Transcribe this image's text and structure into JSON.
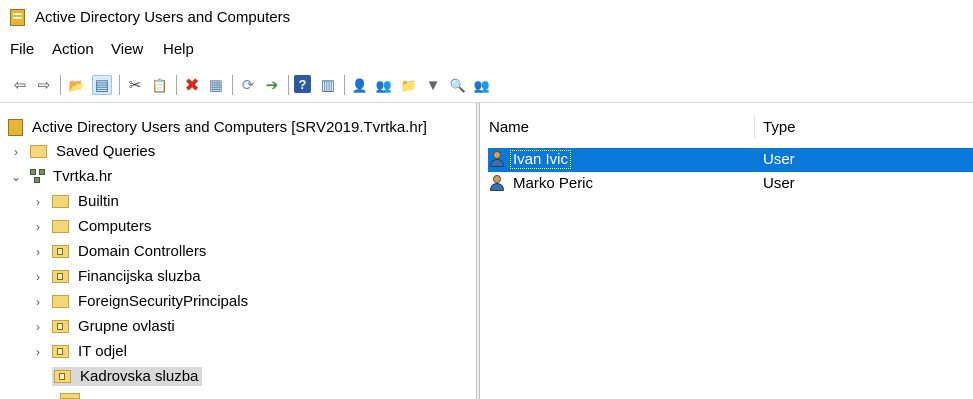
{
  "window": {
    "title": "Active Directory Users and Computers",
    "icon": "aduc-app-icon"
  },
  "menu": [
    {
      "label": "File"
    },
    {
      "label": "Action"
    },
    {
      "label": "View"
    },
    {
      "label": "Help"
    }
  ],
  "toolbar": [
    {
      "name": "back-icon",
      "glyph": "⇦"
    },
    {
      "name": "forward-icon",
      "glyph": "⇨"
    },
    {
      "name": "up-folder-icon",
      "glyph": "📂"
    },
    {
      "name": "show-hide-tree-icon",
      "glyph": "▤"
    },
    {
      "name": "cut-icon",
      "glyph": "✂"
    },
    {
      "name": "copy-icon",
      "glyph": "📋"
    },
    {
      "name": "delete-icon",
      "glyph": "✖"
    },
    {
      "name": "properties-icon",
      "glyph": "▦"
    },
    {
      "name": "refresh-icon",
      "glyph": "⟳"
    },
    {
      "name": "export-list-icon",
      "glyph": "➔"
    },
    {
      "name": "help-icon",
      "glyph": "?"
    },
    {
      "name": "show-pane-icon",
      "glyph": "▥"
    },
    {
      "name": "new-user-icon",
      "glyph": "👤"
    },
    {
      "name": "new-group-icon",
      "glyph": "👥"
    },
    {
      "name": "new-ou-icon",
      "glyph": "📁"
    },
    {
      "name": "filter-icon",
      "glyph": "▼"
    },
    {
      "name": "find-icon",
      "glyph": "🔍"
    },
    {
      "name": "add-to-group-icon",
      "glyph": "👥"
    }
  ],
  "tree": {
    "root": "Active Directory Users and Computers [SRV2019.Tvrtka.hr]",
    "saved_queries": "Saved Queries",
    "domain": "Tvrtka.hr",
    "children": [
      {
        "label": "Builtin",
        "type": "folder"
      },
      {
        "label": "Computers",
        "type": "folder"
      },
      {
        "label": "Domain Controllers",
        "type": "ou"
      },
      {
        "label": "Financijska sluzba",
        "type": "ou"
      },
      {
        "label": "ForeignSecurityPrincipals",
        "type": "folder"
      },
      {
        "label": "Grupne ovlasti",
        "type": "ou"
      },
      {
        "label": "IT odjel",
        "type": "ou"
      },
      {
        "label": "Kadrovska sluzba",
        "type": "ou",
        "selected": true
      }
    ]
  },
  "list": {
    "columns": {
      "name": "Name",
      "type": "Type"
    },
    "rows": [
      {
        "name": "Ivan Ivic",
        "type": "User",
        "selected": true
      },
      {
        "name": "Marko Peric",
        "type": "User",
        "selected": false
      }
    ]
  },
  "colors": {
    "selection": "#0a78d7",
    "tree_selection": "#d9d9d9"
  }
}
